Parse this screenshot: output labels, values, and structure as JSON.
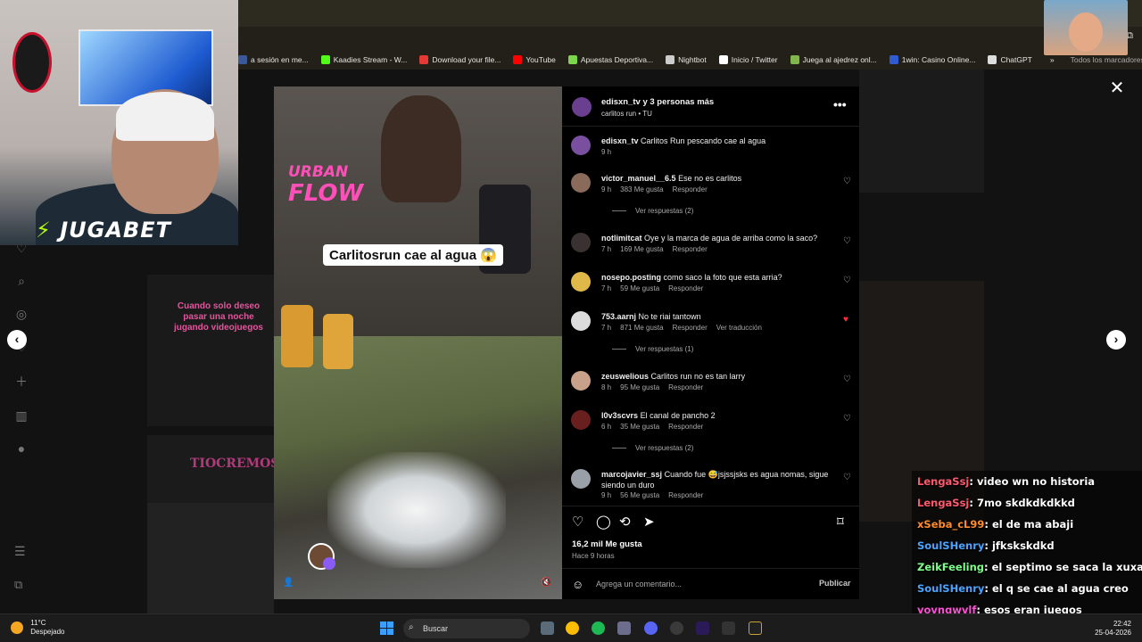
{
  "browser": {
    "bookmarks": [
      {
        "label": "a sesión en me...",
        "color": "#3b5998"
      },
      {
        "label": "Kaadies Stream - W...",
        "color": "#53fc18"
      },
      {
        "label": "Download your file...",
        "color": "#e53935"
      },
      {
        "label": "YouTube",
        "color": "#ff0000"
      },
      {
        "label": "Apuestas Deportiva...",
        "color": "#7cd64b"
      },
      {
        "label": "Nightbot",
        "color": "#cccccc"
      },
      {
        "label": "Inicio / Twitter",
        "color": "#ffffff"
      },
      {
        "label": "Juega al ajedrez onl...",
        "color": "#81b64c"
      },
      {
        "label": "1win: Casino Online...",
        "color": "#2f5bd3"
      },
      {
        "label": "ChatGPT",
        "color": "#dddddd"
      }
    ],
    "more_bookmarks": "»",
    "all_bookmarks": "Todos los marcadores"
  },
  "stream_overlay": {
    "sponsor": "JUGABET"
  },
  "post": {
    "header_title": "edisxn_tv y 3 personas más",
    "header_sub": "carlitos run • TU",
    "video_caption": "Carlitosrun cae al agua 😱",
    "brand_line1": "URBAN",
    "brand_line2": "FLOW",
    "likes": "16,2 mil Me gusta",
    "time": "Hace 9 horas",
    "comment_placeholder": "Agrega un comentario...",
    "publish": "Publicar",
    "more_icon": "•••",
    "close_icon": "✕"
  },
  "comments": [
    {
      "user": "edisxn_tv",
      "text": "Carlitos Run pescando cae al agua",
      "time": "9 h",
      "likes": "",
      "reply": "",
      "translate": "",
      "liked": false,
      "color": "#7a4fa0",
      "replies": ""
    },
    {
      "user": "victor_manuel__6.5",
      "text": "Ese no es carlitos",
      "time": "9 h",
      "likes": "383 Me gusta",
      "reply": "Responder",
      "translate": "",
      "liked": false,
      "color": "#8a6a5a",
      "replies": "Ver respuestas (2)"
    },
    {
      "user": "notlimitcat",
      "text": "Oye y la marca de agua de arriba como la saco?",
      "time": "7 h",
      "likes": "169 Me gusta",
      "reply": "Responder",
      "translate": "",
      "liked": false,
      "color": "#3a3230",
      "replies": ""
    },
    {
      "user": "nosepo.posting",
      "text": "como saco la foto que esta arria?",
      "time": "7 h",
      "likes": "59 Me gusta",
      "reply": "Responder",
      "translate": "",
      "liked": false,
      "color": "#e0b84a",
      "replies": ""
    },
    {
      "user": "753.aarnj",
      "text": "No te riai tantown",
      "time": "7 h",
      "likes": "871 Me gusta",
      "reply": "Responder",
      "translate": "Ver traducción",
      "liked": true,
      "color": "#dcdcdc",
      "replies": "Ver respuestas (1)"
    },
    {
      "user": "zeuswelious",
      "text": "Carlitos run no es tan larry",
      "time": "8 h",
      "likes": "95 Me gusta",
      "reply": "Responder",
      "translate": "",
      "liked": false,
      "color": "#c9a08a",
      "replies": ""
    },
    {
      "user": "l0v3scvrs",
      "text": "El canal de pancho 2",
      "time": "6 h",
      "likes": "35 Me gusta",
      "reply": "Responder",
      "translate": "",
      "liked": false,
      "color": "#6a1f1f",
      "replies": "Ver respuestas (2)"
    },
    {
      "user": "marcojavier_ssj",
      "text": "Cuando fue 😅jsjssjsks es agua nomas, sigue siendo un duro",
      "time": "9 h",
      "likes": "56 Me gusta",
      "reply": "Responder",
      "translate": "",
      "liked": false,
      "color": "#9aa0a8",
      "replies": ""
    }
  ],
  "chat": [
    {
      "user": "LengaSsj",
      "msg": ": video wn no historia",
      "color": "#ff5a6e"
    },
    {
      "user": "LengaSsj",
      "msg": ": 7mo skdkdkdkkd",
      "color": "#ff5a6e"
    },
    {
      "user": "xSeba_cL99",
      "msg": ": el de ma abaji",
      "color": "#ff8c2a"
    },
    {
      "user": "SoulSHenry",
      "msg": ": jfkskskdkd",
      "color": "#4aa3ff"
    },
    {
      "user": "ZeikFeeling",
      "msg": ": el septimo se saca la xuxa",
      "color": "#7dff8a"
    },
    {
      "user": "SoulSHenry",
      "msg": ": el q se cae al agua creo",
      "color": "#4aa3ff"
    },
    {
      "user": "yovngwvlf",
      "msg": ": esos eran juegos",
      "color": "#ff4fd8"
    }
  ],
  "taskbar": {
    "temp": "11°C",
    "weather": "Despejado",
    "search": "Buscar",
    "time": "22:42",
    "date": "25-04-2026"
  },
  "background_text": {
    "meme": "Cuando solo deseo pasar una noche jugando videojuegos",
    "thumb": "TIOCREMOSO"
  }
}
